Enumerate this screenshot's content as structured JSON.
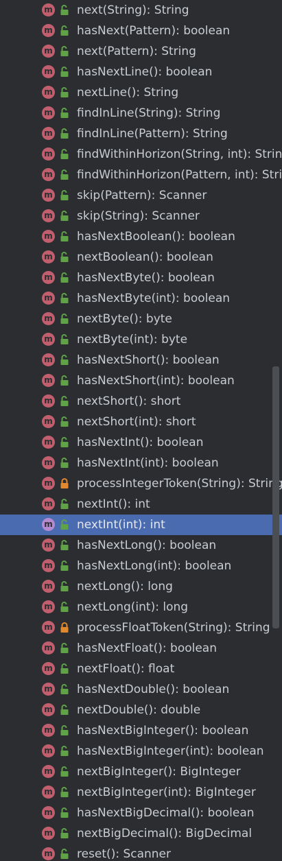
{
  "members": [
    {
      "signature": "next(String): String",
      "visibility": "public",
      "badge": "m"
    },
    {
      "signature": "hasNext(Pattern): boolean",
      "visibility": "public",
      "badge": "m"
    },
    {
      "signature": "next(Pattern): String",
      "visibility": "public",
      "badge": "m"
    },
    {
      "signature": "hasNextLine(): boolean",
      "visibility": "public",
      "badge": "m"
    },
    {
      "signature": "nextLine(): String",
      "visibility": "public",
      "badge": "m"
    },
    {
      "signature": "findInLine(String): String",
      "visibility": "public",
      "badge": "m"
    },
    {
      "signature": "findInLine(Pattern): String",
      "visibility": "public",
      "badge": "m"
    },
    {
      "signature": "findWithinHorizon(String, int): String",
      "visibility": "public",
      "badge": "m"
    },
    {
      "signature": "findWithinHorizon(Pattern, int): String",
      "visibility": "public",
      "badge": "m"
    },
    {
      "signature": "skip(Pattern): Scanner",
      "visibility": "public",
      "badge": "m"
    },
    {
      "signature": "skip(String): Scanner",
      "visibility": "public",
      "badge": "m"
    },
    {
      "signature": "hasNextBoolean(): boolean",
      "visibility": "public",
      "badge": "m"
    },
    {
      "signature": "nextBoolean(): boolean",
      "visibility": "public",
      "badge": "m"
    },
    {
      "signature": "hasNextByte(): boolean",
      "visibility": "public",
      "badge": "m"
    },
    {
      "signature": "hasNextByte(int): boolean",
      "visibility": "public",
      "badge": "m"
    },
    {
      "signature": "nextByte(): byte",
      "visibility": "public",
      "badge": "m"
    },
    {
      "signature": "nextByte(int): byte",
      "visibility": "public",
      "badge": "m"
    },
    {
      "signature": "hasNextShort(): boolean",
      "visibility": "public",
      "badge": "m"
    },
    {
      "signature": "hasNextShort(int): boolean",
      "visibility": "public",
      "badge": "m"
    },
    {
      "signature": "nextShort(): short",
      "visibility": "public",
      "badge": "m"
    },
    {
      "signature": "nextShort(int): short",
      "visibility": "public",
      "badge": "m"
    },
    {
      "signature": "hasNextInt(): boolean",
      "visibility": "public",
      "badge": "m"
    },
    {
      "signature": "hasNextInt(int): boolean",
      "visibility": "public",
      "badge": "m"
    },
    {
      "signature": "processIntegerToken(String): String",
      "visibility": "private",
      "badge": "m"
    },
    {
      "signature": "nextInt(): int",
      "visibility": "public",
      "badge": "m"
    },
    {
      "signature": "nextInt(int): int",
      "visibility": "public",
      "badge": "m",
      "selected": true
    },
    {
      "signature": "hasNextLong(): boolean",
      "visibility": "public",
      "badge": "m"
    },
    {
      "signature": "hasNextLong(int): boolean",
      "visibility": "public",
      "badge": "m"
    },
    {
      "signature": "nextLong(): long",
      "visibility": "public",
      "badge": "m"
    },
    {
      "signature": "nextLong(int): long",
      "visibility": "public",
      "badge": "m"
    },
    {
      "signature": "processFloatToken(String): String",
      "visibility": "private",
      "badge": "m"
    },
    {
      "signature": "hasNextFloat(): boolean",
      "visibility": "public",
      "badge": "m"
    },
    {
      "signature": "nextFloat(): float",
      "visibility": "public",
      "badge": "m"
    },
    {
      "signature": "hasNextDouble(): boolean",
      "visibility": "public",
      "badge": "m"
    },
    {
      "signature": "nextDouble(): double",
      "visibility": "public",
      "badge": "m"
    },
    {
      "signature": "hasNextBigInteger(): boolean",
      "visibility": "public",
      "badge": "m"
    },
    {
      "signature": "hasNextBigInteger(int): boolean",
      "visibility": "public",
      "badge": "m"
    },
    {
      "signature": "nextBigInteger(): BigInteger",
      "visibility": "public",
      "badge": "m"
    },
    {
      "signature": "nextBigInteger(int): BigInteger",
      "visibility": "public",
      "badge": "m"
    },
    {
      "signature": "hasNextBigDecimal(): boolean",
      "visibility": "public",
      "badge": "m"
    },
    {
      "signature": "nextBigDecimal(): BigDecimal",
      "visibility": "public",
      "badge": "m"
    },
    {
      "signature": "reset(): Scanner",
      "visibility": "public",
      "badge": "m"
    }
  ],
  "icons": {
    "method": "method-m-badge-icon",
    "public": "unlocked-padlock-icon",
    "private": "locked-padlock-icon"
  },
  "colors": {
    "background": "#2b2d30",
    "selection": "#4a6bb0",
    "method_badge": "#c25f6f",
    "method_badge_selected": "#b68ad0",
    "public_lock": "#5fa247",
    "private_lock": "#e0892e",
    "text": "#c9cdd2"
  }
}
